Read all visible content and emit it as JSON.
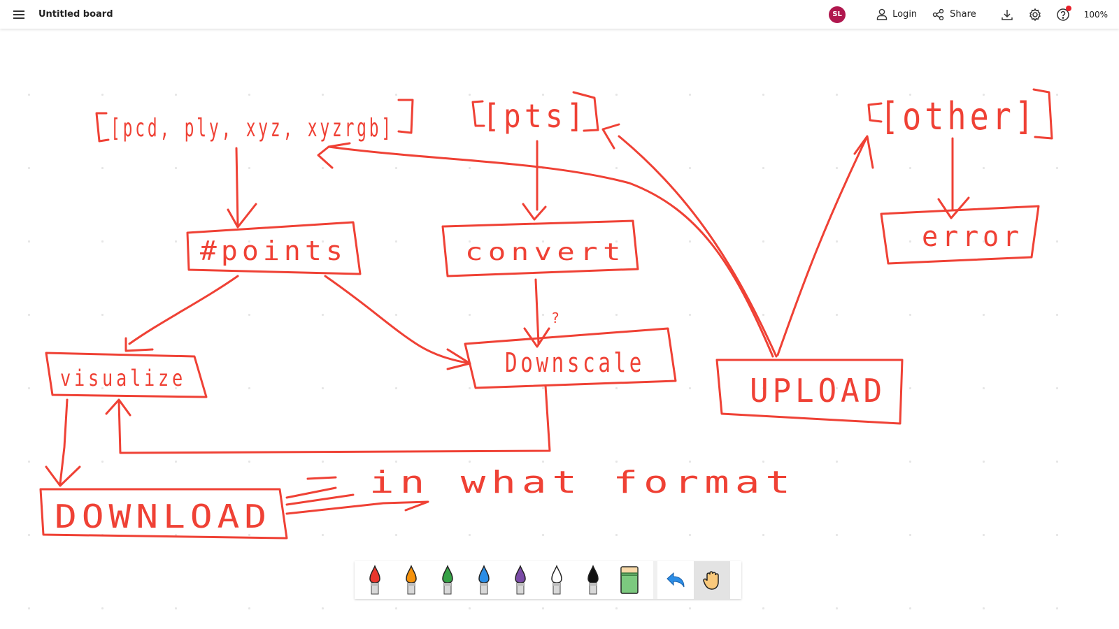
{
  "header": {
    "title": "Untitled board",
    "avatar_initials": "SL",
    "avatar_color": "#b0174e",
    "login_label": "Login",
    "share_label": "Share",
    "zoom_level": "100%",
    "icons": [
      "menu-icon",
      "user-icon",
      "share-icon",
      "download-icon",
      "gear-icon",
      "help-icon"
    ]
  },
  "board": {
    "ink_color": "#ef4135",
    "texts": {
      "formats": "[pcd, ply, xyz, xyzrgb]",
      "pts": "[pts]",
      "other": "[other]",
      "points": "#points",
      "convert": "convert",
      "error": "error",
      "visualize": "visualize",
      "downscale": "Downscale",
      "question": "?",
      "upload": "UPLOAD",
      "download": "DOWNLOAD",
      "in_what_format": "in what format"
    }
  },
  "toolbar": {
    "pens": [
      {
        "name": "red",
        "color": "#e8362d"
      },
      {
        "name": "orange",
        "color": "#f5920c"
      },
      {
        "name": "green",
        "color": "#36a146"
      },
      {
        "name": "blue",
        "color": "#2b8de6"
      },
      {
        "name": "purple",
        "color": "#7a4aa6"
      },
      {
        "name": "white",
        "color": "#ffffff"
      },
      {
        "name": "black",
        "color": "#111111"
      }
    ],
    "eraser_color": "#7cc97f",
    "tools": [
      "undo-icon",
      "hand-icon"
    ],
    "active_tool": "hand"
  }
}
